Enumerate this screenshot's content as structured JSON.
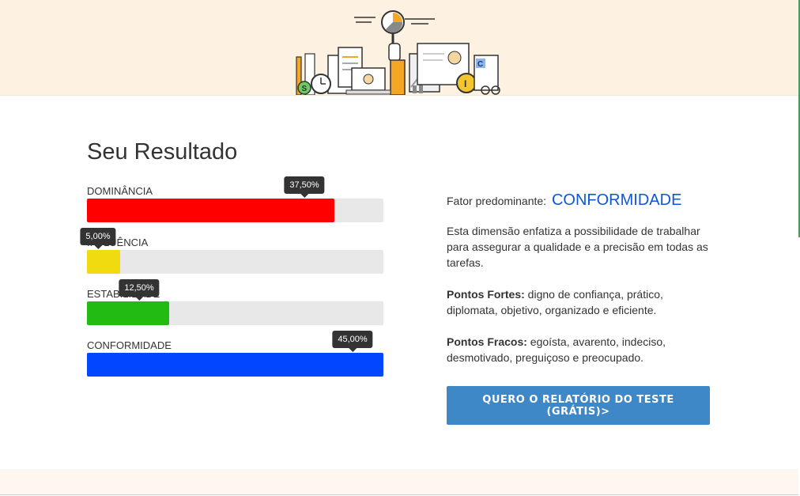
{
  "header": {
    "illustration": "dashboard-analytics-illustration"
  },
  "result": {
    "title": "Seu Resultado",
    "bars": [
      {
        "label": "DOMINÂNCIA",
        "value": 37.5,
        "value_text": "37,50%",
        "color": "#ff0000"
      },
      {
        "label": "INFLUÊNCIA",
        "value": 5.0,
        "value_text": "5,00%",
        "color": "#f0da10"
      },
      {
        "label": "ESTABILIDADE",
        "value": 12.5,
        "value_text": "12,50%",
        "color": "#22bb11"
      },
      {
        "label": "CONFORMIDADE",
        "value": 45.0,
        "value_text": "45,00%",
        "color": "#0047ff"
      }
    ]
  },
  "summary": {
    "factor_label": "Fator predominante:",
    "factor_value": "CONFORMIDADE",
    "description": "Esta dimensão enfatiza a possibilidade de trabalhar para assegurar a qualidade e a precisão em todas as tarefas.",
    "strengths_label": "Pontos Fortes:",
    "strengths_text": " digno de confiança, prático, diplomata, objetivo, organizado e eficiente.",
    "weaknesses_label": "Pontos Fracos:",
    "weaknesses_text": " egoísta, avarento, indeciso, desmotivado, preguiçoso e preocupado."
  },
  "cta": {
    "label": "QUERO O RELATÓRIO DO TESTE (GRÁTIS)>"
  },
  "colors": {
    "accent": "#0f56d8",
    "button": "#3f88c7",
    "banner": "#fdf1e2"
  }
}
